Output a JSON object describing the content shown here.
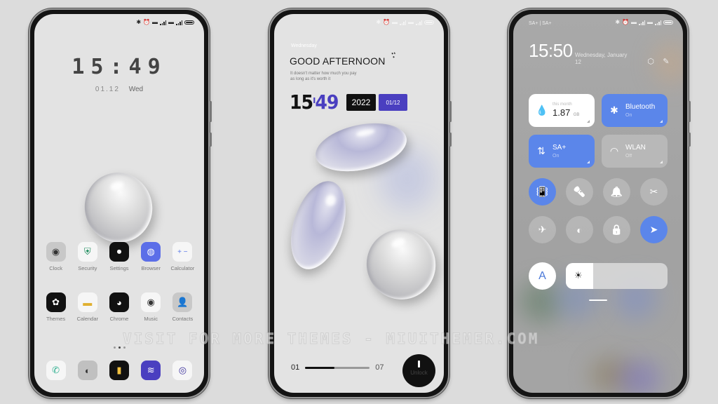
{
  "watermark": "VISIT FOR MORE THEMES - MIUITHEMER.COM",
  "colors": {
    "accent_purple": "#4a3fc0",
    "accent_blue": "#5b86ea",
    "background": "#dcdcdc"
  },
  "home_screen": {
    "clock": "15:49",
    "date": "01.12",
    "weekday": "Wed",
    "status_icons": [
      "bluetooth-icon",
      "alarm-icon",
      "sim1-icon",
      "signal1-icon",
      "sim2-icon",
      "signal2-icon",
      "battery-icon"
    ],
    "apps_row1": [
      {
        "label": "Clock",
        "icon": "clock-icon",
        "bg": "#c8c8c8",
        "glyph": "◉"
      },
      {
        "label": "Security",
        "icon": "shield-icon",
        "bg": "#f6f6f6",
        "glyph": "⛨"
      },
      {
        "label": "Settings",
        "icon": "toggle-icon",
        "bg": "#111111",
        "glyph": "⏺"
      },
      {
        "label": "Browser",
        "icon": "planet-icon",
        "bg": "#5b6ee8",
        "glyph": "◍"
      },
      {
        "label": "Calculator",
        "icon": "plus-minus-icon",
        "bg": "#f6f6f6",
        "glyph": "+ −"
      }
    ],
    "apps_row2": [
      {
        "label": "Themes",
        "icon": "palette-icon",
        "bg": "#111111",
        "glyph": "✿"
      },
      {
        "label": "Calendar",
        "icon": "calendar-icon",
        "bg": "#f6f6f6",
        "glyph": "▬"
      },
      {
        "label": "Chrome",
        "icon": "chrome-icon",
        "bg": "#111111",
        "glyph": "◕"
      },
      {
        "label": "Music",
        "icon": "vinyl-icon",
        "bg": "#f6f6f6",
        "glyph": "◉"
      },
      {
        "label": "Contacts",
        "icon": "person-icon",
        "bg": "#c8c8c8",
        "glyph": "👤"
      }
    ],
    "page_indicator": {
      "count": 3,
      "active": 1
    },
    "dock": [
      {
        "icon": "phone-icon",
        "bg": "#f6f6f6",
        "glyph": "✆"
      },
      {
        "icon": "messages-icon",
        "bg": "#c0c0c0",
        "glyph": "◐"
      },
      {
        "icon": "notes-icon",
        "bg": "#111111",
        "glyph": "▮"
      },
      {
        "icon": "gallery-icon",
        "bg": "#4a3fc0",
        "glyph": "≋"
      },
      {
        "icon": "camera-icon",
        "bg": "#f6f6f6",
        "glyph": "◎"
      }
    ]
  },
  "lock_screen": {
    "weekday": "Wednesday",
    "greeting": "GOOD AFTERNOON",
    "subtitle_line1": "It doesn't matter how much you pay",
    "subtitle_line2": "as long as it's worth it",
    "time_hour": "15",
    "time_minute": "49",
    "year": "2022",
    "month_day": "01/12",
    "progress_start": "01",
    "progress_end": "07",
    "progress_fraction": 0.45,
    "unlock_label": "Unlock"
  },
  "control_center": {
    "carrier": "SA+ | SA+",
    "time": "15:50",
    "date_line1": "Wednesday, January",
    "date_line2": "12",
    "data_tile": {
      "caption": "this month",
      "value": "1.87",
      "unit": "GB"
    },
    "bluetooth_tile": {
      "title": "Bluetooth",
      "status": "On"
    },
    "mobile_data_tile": {
      "title": "SA+",
      "status": "On"
    },
    "wlan_tile": {
      "title": "WLAN",
      "status": "Off"
    },
    "toggles_row1": [
      {
        "name": "vibrate",
        "active": true,
        "glyph": "📳"
      },
      {
        "name": "flashlight",
        "active": false,
        "glyph": "🔦"
      },
      {
        "name": "bell",
        "active": false,
        "glyph": "🔔"
      },
      {
        "name": "screenshot",
        "active": false,
        "glyph": "✂"
      }
    ],
    "toggles_row2": [
      {
        "name": "airplane",
        "active": false,
        "glyph": "✈"
      },
      {
        "name": "reading-mode",
        "active": false,
        "glyph": "◐"
      },
      {
        "name": "lock",
        "active": false,
        "glyph": "🔒"
      },
      {
        "name": "location",
        "active": true,
        "glyph": "➤"
      }
    ],
    "auto_brightness_label": "A",
    "brightness_fraction": 0.27
  }
}
